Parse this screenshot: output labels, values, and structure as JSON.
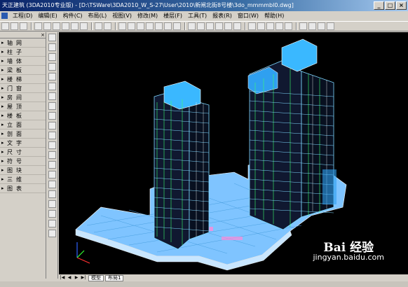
{
  "window": {
    "title": "天正建筑 (3DA2010专业版) - [D:\\TSWare\\3DA2010_W_S-27\\User\\2010\\新闸北街8号楼\\3do_mmmmbl0.dwg]",
    "min_label": "_",
    "max_label": "□",
    "close_label": "×"
  },
  "menu": {
    "items": [
      "工程(D)",
      "编辑(E)",
      "构件(C)",
      "布局(L)",
      "视图(V)",
      "修改(M)",
      "楼层(F)",
      "工具(T)",
      "报表(R)",
      "窗口(W)",
      "帮助(H)"
    ]
  },
  "sidebar": {
    "close_label": "×",
    "items": [
      {
        "label": "轴网"
      },
      {
        "label": "柱子"
      },
      {
        "label": "墙体"
      },
      {
        "label": "梁板"
      },
      {
        "label": "楼梯"
      },
      {
        "label": "门窗"
      },
      {
        "label": "房间"
      },
      {
        "label": "屋顶"
      },
      {
        "label": "楼板"
      },
      {
        "label": "立面"
      },
      {
        "label": "剖面"
      },
      {
        "label": "文字"
      },
      {
        "label": "尺寸"
      },
      {
        "label": "符号"
      },
      {
        "label": "图块"
      },
      {
        "label": "三维"
      },
      {
        "label": "图表"
      }
    ]
  },
  "status": {
    "nav_first": "|◀",
    "nav_prev": "◀",
    "nav_next": "▶",
    "nav_last": "▶|",
    "tab_model": "模型",
    "tab_layout": "布局1"
  },
  "watermark": {
    "logo_text": "Bai 经验",
    "url": "jingyan.baidu.com"
  },
  "colors": {
    "viewport_bg": "#000000",
    "building_cyan": "#7fd8ff",
    "building_green": "#39ff6a",
    "building_white": "#e8f4ff",
    "podium_blue": "#8ec8ff",
    "title_gradient_start": "#0a246a"
  }
}
